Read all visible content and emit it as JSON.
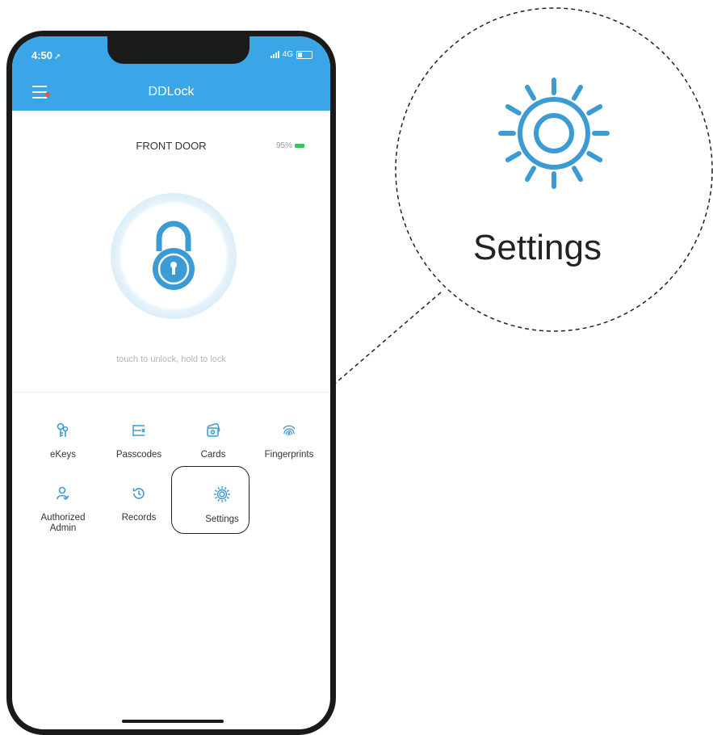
{
  "status_bar": {
    "time": "4:50",
    "network": "4G"
  },
  "nav": {
    "title": "DDLock"
  },
  "lock": {
    "door_name": "FRONT DOOR",
    "battery": "95%",
    "hint": "touch to unlock, hold to lock"
  },
  "menu": {
    "row1": [
      {
        "label": "eKeys",
        "icon": "ekeys-icon"
      },
      {
        "label": "Passcodes",
        "icon": "passcodes-icon"
      },
      {
        "label": "Cards",
        "icon": "cards-icon"
      },
      {
        "label": "Fingerprints",
        "icon": "fingerprint-icon"
      }
    ],
    "row2": [
      {
        "label": "Authorized\nAdmin",
        "icon": "authorized-admin-icon"
      },
      {
        "label": "Records",
        "icon": "records-icon"
      },
      {
        "label": "Settings",
        "icon": "gear-icon"
      }
    ]
  },
  "callout": {
    "label": "Settings",
    "icon": "gear-icon"
  },
  "colors": {
    "accent": "#3aa6e8",
    "battery_green": "#35c55a"
  }
}
